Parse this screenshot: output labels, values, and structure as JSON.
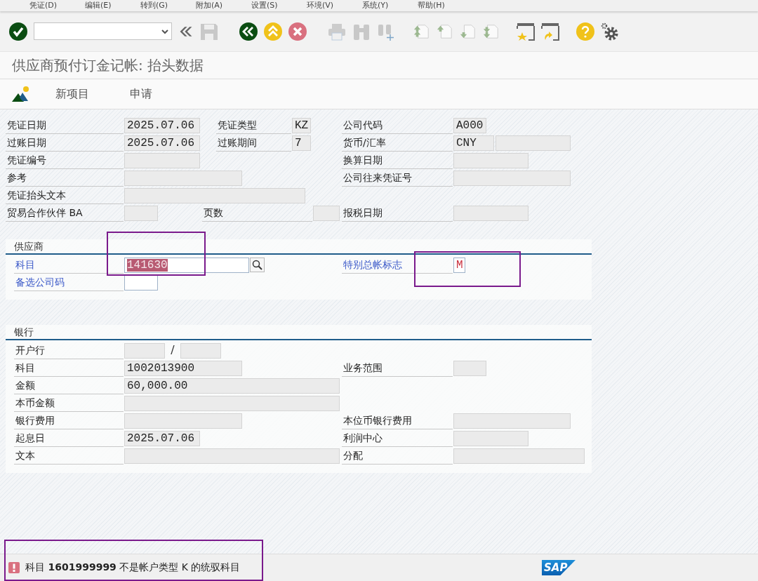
{
  "menu": [
    "凭证(D)",
    "编辑(E)",
    "转到(G)",
    "附加(A)",
    "设置(S)",
    "环境(V)",
    "系统(Y)",
    "帮助(H)"
  ],
  "title": "供应商预付订金记帐: 抬头数据",
  "app_toolbar": [
    "新项目",
    "申请"
  ],
  "header": {
    "rows": [
      [
        {
          "kind": "label",
          "text": "凭证日期"
        },
        {
          "kind": "field",
          "value": "2025.07.06",
          "editable": false
        },
        {
          "kind": "label",
          "text": "凭证类型"
        },
        {
          "kind": "field",
          "value": "KZ",
          "editable": false
        },
        {
          "kind": "label",
          "text": "公司代码"
        },
        {
          "kind": "field",
          "value": "A000",
          "editable": false
        }
      ],
      [
        {
          "kind": "label",
          "text": "过账日期"
        },
        {
          "kind": "field",
          "value": "2025.07.06",
          "editable": false
        },
        {
          "kind": "label",
          "text": "过账期间"
        },
        {
          "kind": "field",
          "value": "7",
          "editable": false
        },
        {
          "kind": "label",
          "text": "货币/汇率"
        },
        {
          "kind": "field",
          "value": "CNY",
          "editable": false
        },
        {
          "kind": "field",
          "editable": false
        }
      ],
      [
        {
          "kind": "label",
          "text": "凭证编号"
        },
        {
          "kind": "field",
          "editable": false
        },
        {
          "kind": "label",
          "text": "换算日期"
        },
        {
          "kind": "field",
          "editable": false
        }
      ],
      [
        {
          "kind": "label",
          "text": "参考"
        },
        {
          "kind": "field",
          "editable": false
        },
        {
          "kind": "label",
          "text": "公司往来凭证号"
        },
        {
          "kind": "field",
          "editable": false
        }
      ],
      [
        {
          "kind": "label",
          "text": "凭证抬头文本"
        },
        {
          "kind": "field",
          "editable": false
        }
      ],
      [
        {
          "kind": "label",
          "text": "贸易合作伙伴 BA"
        },
        {
          "kind": "field",
          "editable": false
        },
        {
          "kind": "label",
          "text": "页数"
        },
        {
          "kind": "field",
          "editable": false
        },
        {
          "kind": "label",
          "text": "报税日期"
        },
        {
          "kind": "field",
          "editable": false
        }
      ]
    ]
  },
  "vendor": {
    "title": "供应商",
    "rows": [
      [
        {
          "kind": "label",
          "text": "科目"
        },
        {
          "kind": "field",
          "value": "141630",
          "editable": true,
          "text_selected": true
        },
        {
          "kind": "search_button"
        },
        {
          "kind": "label",
          "text": "特别总帐标志"
        },
        {
          "kind": "field",
          "value": "M",
          "editable": true,
          "text_selected": false
        }
      ],
      [
        {
          "kind": "label",
          "text": "备选公司码"
        },
        {
          "kind": "field",
          "editable": true
        }
      ]
    ]
  },
  "bank": {
    "title": "银行",
    "rows": [
      [
        {
          "kind": "label",
          "text": "开户行"
        },
        {
          "kind": "field_pair",
          "separator": "/",
          "fields": [
            {
              "editable": false
            },
            {
              "editable": false
            }
          ]
        }
      ],
      [
        {
          "kind": "label",
          "text": "科目"
        },
        {
          "kind": "field",
          "value": "1002013900",
          "editable": false
        },
        {
          "kind": "label",
          "text": "业务范围"
        },
        {
          "kind": "field",
          "editable": false
        }
      ],
      [
        {
          "kind": "label",
          "text": "金额"
        },
        {
          "kind": "field",
          "value": "60,000.00",
          "editable": false
        }
      ],
      [
        {
          "kind": "label",
          "text": "本币金额"
        },
        {
          "kind": "field",
          "editable": false
        }
      ],
      [
        {
          "kind": "label",
          "text": "银行费用"
        },
        {
          "kind": "field",
          "editable": false
        },
        {
          "kind": "label",
          "text": "本位币银行费用"
        },
        {
          "kind": "field",
          "editable": false
        }
      ],
      [
        {
          "kind": "label",
          "text": "起息日"
        },
        {
          "kind": "field",
          "value": "2025.07.06",
          "editable": false
        },
        {
          "kind": "label",
          "text": "利润中心"
        },
        {
          "kind": "field",
          "editable": false
        }
      ],
      [
        {
          "kind": "label",
          "text": "文本"
        },
        {
          "kind": "field",
          "editable": false
        },
        {
          "kind": "label",
          "text": "分配"
        },
        {
          "kind": "field",
          "editable": false
        }
      ]
    ]
  },
  "status_bar": {
    "message": "科目 **1601999999** 不是帐户类型 K 的统驭科目",
    "logo": "SAP"
  }
}
